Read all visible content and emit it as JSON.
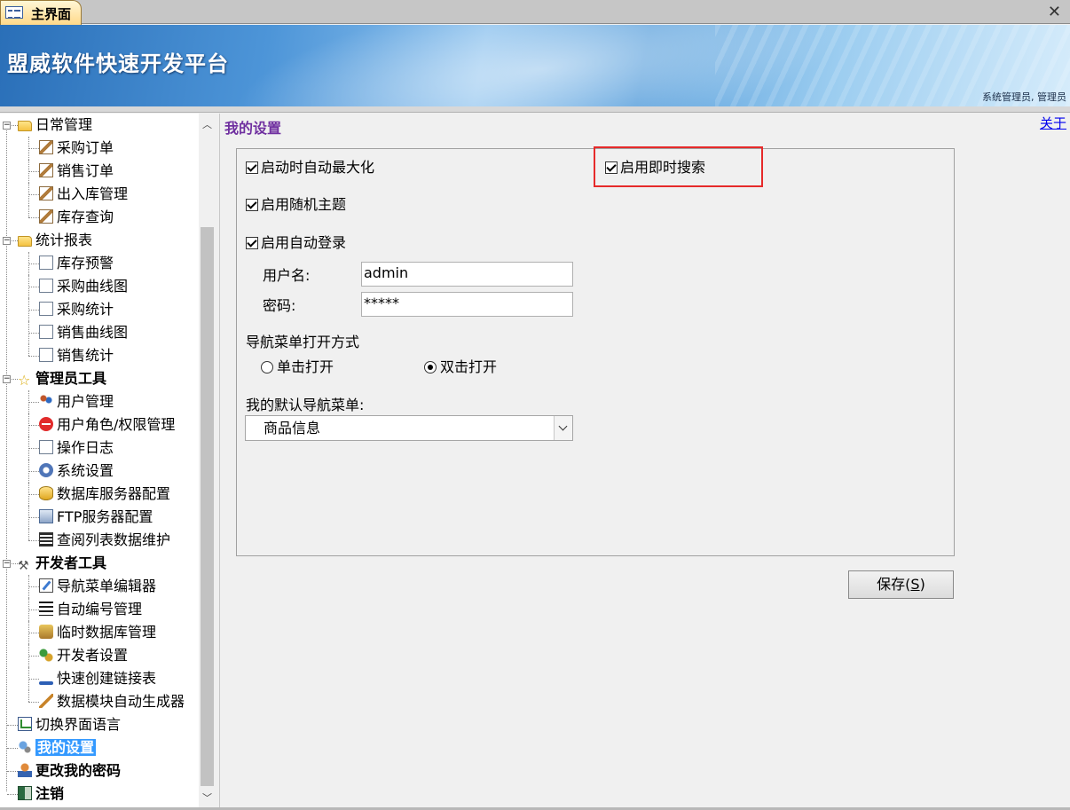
{
  "tab": {
    "title": "主界面"
  },
  "banner": {
    "title": "盟威软件快速开发平台",
    "user_info": "系统管理员, 管理员"
  },
  "about_link": "关于",
  "nav": {
    "items": [
      {
        "label": "日常管理",
        "level": 0,
        "icon": "folder-open-icon",
        "expander": "−"
      },
      {
        "label": "采购订单",
        "level": 1,
        "icon": "pen-icon"
      },
      {
        "label": "销售订单",
        "level": 1,
        "icon": "pen-icon"
      },
      {
        "label": "出入库管理",
        "level": 1,
        "icon": "pen-icon"
      },
      {
        "label": "库存查询",
        "level": 1,
        "icon": "pen-icon"
      },
      {
        "label": "统计报表",
        "level": 0,
        "icon": "folder-open-icon",
        "expander": "−"
      },
      {
        "label": "库存预警",
        "level": 1,
        "icon": "document-icon"
      },
      {
        "label": "采购曲线图",
        "level": 1,
        "icon": "document-icon"
      },
      {
        "label": "采购统计",
        "level": 1,
        "icon": "document-icon"
      },
      {
        "label": "销售曲线图",
        "level": 1,
        "icon": "document-icon"
      },
      {
        "label": "销售统计",
        "level": 1,
        "icon": "document-icon"
      },
      {
        "label": "管理员工具",
        "level": 0,
        "icon": "star-icon",
        "expander": "−",
        "bold": true
      },
      {
        "label": "用户管理",
        "level": 1,
        "icon": "users-icon"
      },
      {
        "label": "用户角色/权限管理",
        "level": 1,
        "icon": "no-entry-icon"
      },
      {
        "label": "操作日志",
        "level": 1,
        "icon": "document-icon"
      },
      {
        "label": "系统设置",
        "level": 1,
        "icon": "settings-icon"
      },
      {
        "label": "数据库服务器配置",
        "level": 1,
        "icon": "database-icon"
      },
      {
        "label": "FTP服务器配置",
        "level": 1,
        "icon": "ftp-server-icon"
      },
      {
        "label": "查阅列表数据维护",
        "level": 1,
        "icon": "list-icon"
      },
      {
        "label": "开发者工具",
        "level": 0,
        "icon": "tools-icon",
        "expander": "−",
        "bold": true
      },
      {
        "label": "导航菜单编辑器",
        "level": 1,
        "icon": "edit-icon"
      },
      {
        "label": "自动编号管理",
        "level": 1,
        "icon": "numbered-list-icon"
      },
      {
        "label": "临时数据库管理",
        "level": 1,
        "icon": "temp-database-icon"
      },
      {
        "label": "开发者设置",
        "level": 1,
        "icon": "developer-settings-icon"
      },
      {
        "label": "快速创建链接表",
        "level": 1,
        "icon": "link-icon"
      },
      {
        "label": "数据模块自动生成器",
        "level": 1,
        "icon": "magic-wand-icon"
      },
      {
        "label": "切换界面语言",
        "level": 0,
        "icon": "chart-icon"
      },
      {
        "label": "我的设置",
        "level": 0,
        "icon": "my-settings-icon",
        "bold": true,
        "selected": true
      },
      {
        "label": "更改我的密码",
        "level": 0,
        "icon": "change-password-icon",
        "bold": true
      },
      {
        "label": "注销",
        "level": 0,
        "icon": "logout-icon",
        "bold": true
      }
    ]
  },
  "settings": {
    "title": "我的设置",
    "auto_maximize": {
      "label": "启动时自动最大化",
      "checked": true
    },
    "instant_search": {
      "label": "启用即时搜索",
      "checked": true
    },
    "random_theme": {
      "label": "启用随机主题",
      "checked": true
    },
    "auto_login": {
      "label": "启用自动登录",
      "checked": true
    },
    "username_label": "用户名:",
    "username_value": "admin",
    "password_label": "密码:",
    "password_value": "*****",
    "nav_open_mode_label": "导航菜单打开方式",
    "radio_single": {
      "label": "单击打开",
      "selected": false
    },
    "radio_double": {
      "label": "双击打开",
      "selected": true
    },
    "default_nav_label": "我的默认导航菜单:",
    "default_nav_value": "商品信息",
    "save_label": "保存(",
    "save_hotkey": "S",
    "save_label_end": ")"
  },
  "colors": {
    "title_purple": "#7030a0",
    "highlight_red": "#e62a2a",
    "selected_blue": "#3399ff"
  }
}
